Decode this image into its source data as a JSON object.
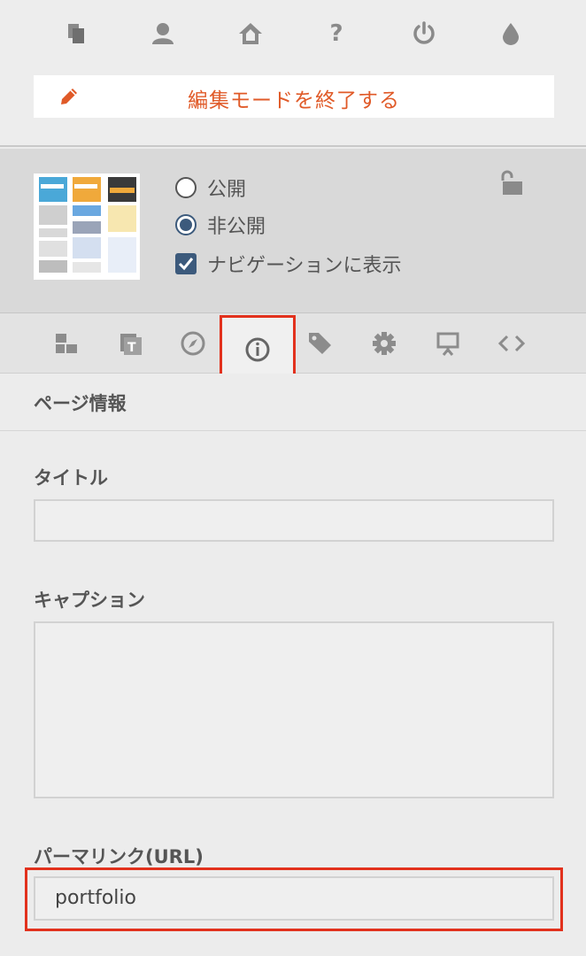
{
  "toolbar": {
    "icons": [
      "pages-icon",
      "user-icon",
      "home-icon",
      "help-icon",
      "power-icon",
      "drop-icon"
    ],
    "help_glyph": "?",
    "edit_mode_label": "編集モードを終了する"
  },
  "visibility": {
    "public_label": "公開",
    "private_label": "非公開",
    "selected": "private",
    "nav_label": "ナビゲーションに表示",
    "nav_checked": true
  },
  "tabs": [
    {
      "icon": "blocks-icon"
    },
    {
      "icon": "text-icon"
    },
    {
      "icon": "compass-icon"
    },
    {
      "icon": "info-icon",
      "active": true
    },
    {
      "icon": "tag-icon"
    },
    {
      "icon": "gear-icon"
    },
    {
      "icon": "presentation-icon"
    },
    {
      "icon": "code-icon"
    }
  ],
  "page_info": {
    "title": "ページ情報",
    "title_field_label": "タイトル",
    "title_value": "",
    "caption_label": "キャプション",
    "caption_value": "",
    "permalink_label": "パーマリンク(URL)",
    "permalink_value": "portfolio"
  },
  "colors": {
    "accent": "#e05a28",
    "highlight": "#e2311d",
    "control": "#3c5a7c"
  }
}
